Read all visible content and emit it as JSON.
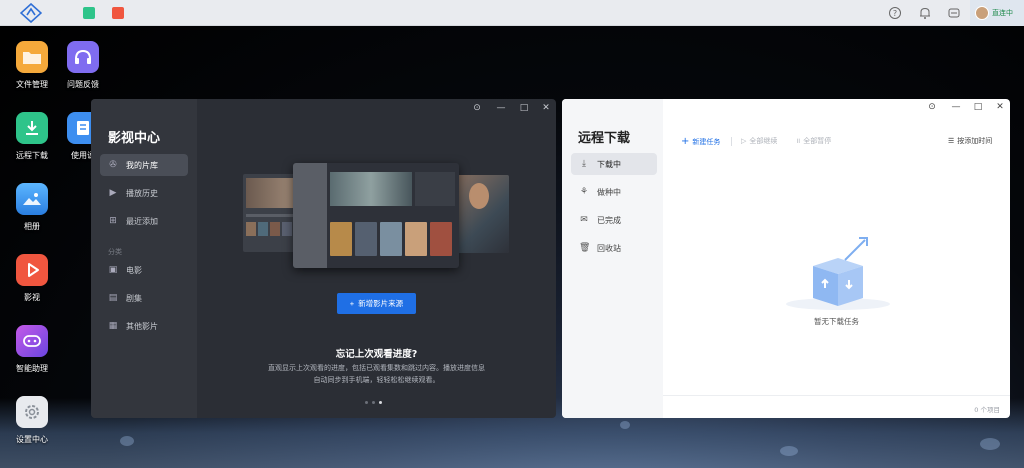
{
  "desktop": {
    "icons": [
      {
        "label": "文件管理",
        "icon": "folder-icon",
        "color": "#f5a93b"
      },
      {
        "label": "问题反馈",
        "icon": "headset-icon",
        "color": "#7f6cf0"
      },
      {
        "label": "远程下载",
        "icon": "download-icon",
        "color": "#2ec48a"
      },
      {
        "label": "使用说",
        "icon": "manual-icon",
        "color": "#3d8ef0"
      },
      {
        "label": "相册",
        "icon": "photo-icon",
        "color": "#3a9cf2"
      },
      {
        "label": "影视",
        "icon": "play-icon",
        "color": "#f0563f"
      },
      {
        "label": "智能助理",
        "icon": "assistant-icon",
        "color": "#a047e8"
      },
      {
        "label": "设置中心",
        "icon": "gear-icon",
        "color": "#8a9099"
      }
    ]
  },
  "topbar": {
    "user_status": "直连中"
  },
  "video_center": {
    "title": "影视中心",
    "nav": [
      {
        "label": "我的片库",
        "icon": "film-reel-icon",
        "active": true
      },
      {
        "label": "播放历史",
        "icon": "history-icon",
        "active": false
      },
      {
        "label": "最近添加",
        "icon": "recent-add-icon",
        "active": false
      }
    ],
    "group_label": "分类",
    "categories": [
      {
        "label": "电影",
        "icon": "movie-icon"
      },
      {
        "label": "剧集",
        "icon": "series-icon"
      },
      {
        "label": "其他影片",
        "icon": "other-video-icon"
      }
    ],
    "add_source_button": "新增影片来源",
    "tip_title": "忘记上次观看进度?",
    "tip_body": "直观显示上次观看的进度，包括已观看集数和跳过内容。播放进度信息自动同步到手机端，轻轻松松继续观看。",
    "carousel_pages": 3,
    "carousel_active": 2
  },
  "remote_download": {
    "title": "远程下载",
    "nav": [
      {
        "label": "下载中",
        "icon": "downloading-icon",
        "active": true
      },
      {
        "label": "做种中",
        "icon": "seeding-icon",
        "active": false
      },
      {
        "label": "已完成",
        "icon": "completed-icon",
        "active": false
      },
      {
        "label": "回收站",
        "icon": "trash-icon",
        "active": false
      }
    ],
    "toolbar": {
      "new_task": "新建任务",
      "resume_all": "全部继续",
      "pause_all": "全部暂停",
      "sort": "按添加时间"
    },
    "empty_text": "暂无下载任务",
    "item_count": "0 个项目"
  }
}
